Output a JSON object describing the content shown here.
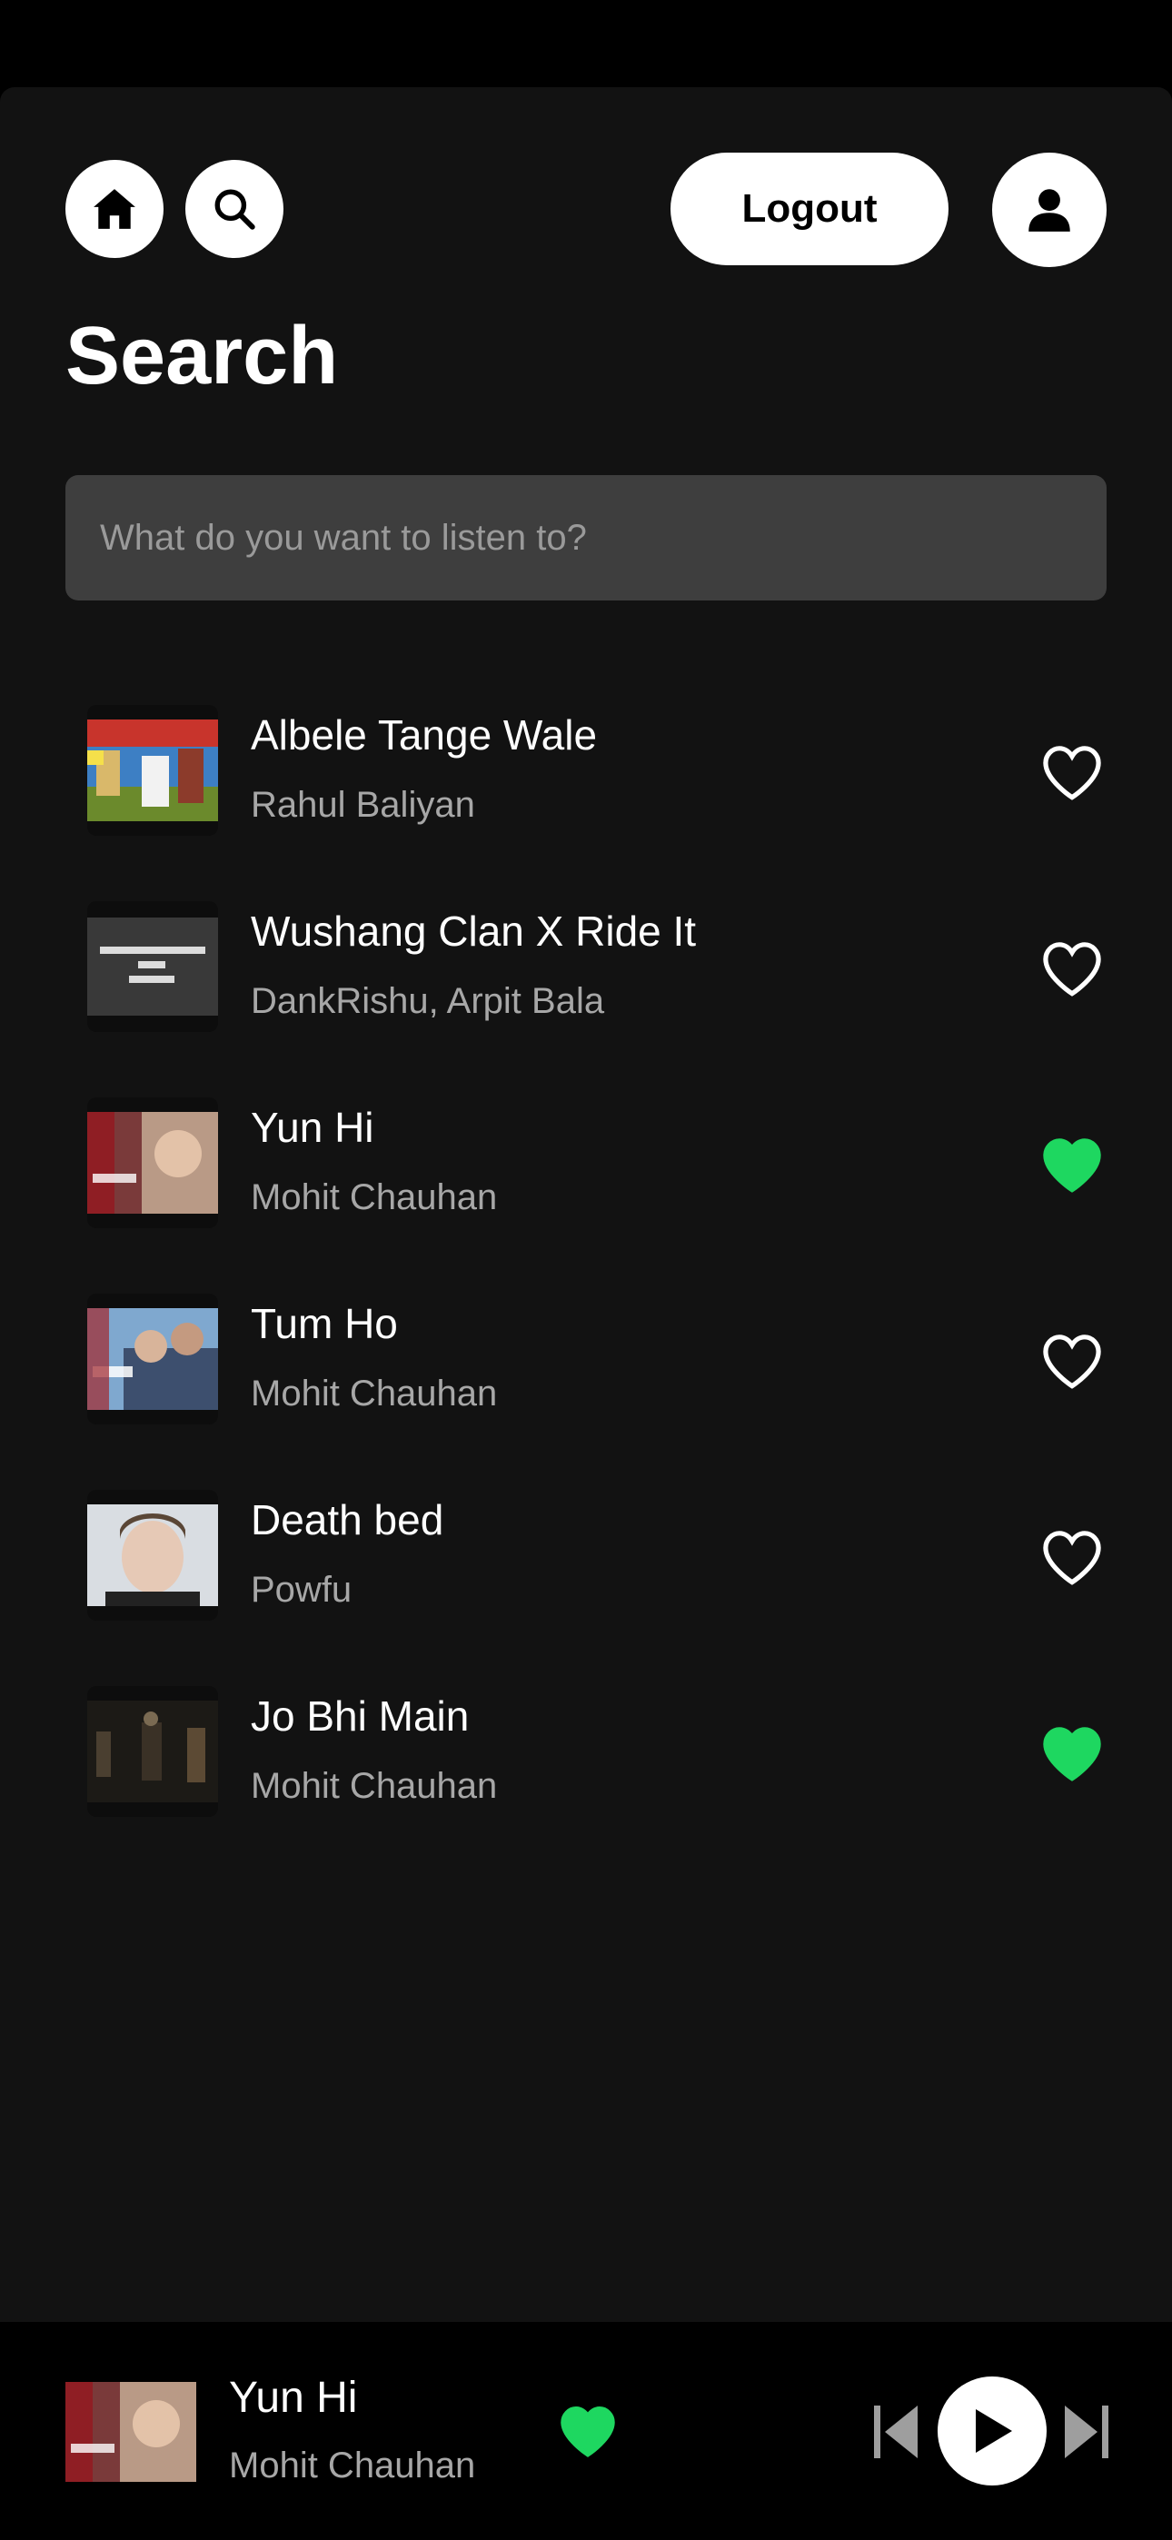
{
  "header": {
    "home_icon": "home-icon",
    "search_icon": "search-icon",
    "logout_label": "Logout",
    "profile_icon": "user-icon"
  },
  "page_title": "Search",
  "search": {
    "placeholder": "What do you want to listen to?",
    "value": ""
  },
  "colors": {
    "accent_green": "#1ed760",
    "panel_bg": "#121212",
    "input_bg": "#3e3e3e",
    "secondary_text": "#a7a7a7"
  },
  "songs": [
    {
      "title": "Albele Tange Wale",
      "artist": "Rahul Baliyan",
      "liked": false
    },
    {
      "title": "Wushang Clan X Ride It",
      "artist": "DankRishu, Arpit Bala",
      "liked": false
    },
    {
      "title": "Yun Hi",
      "artist": "Mohit Chauhan",
      "liked": true
    },
    {
      "title": "Tum Ho",
      "artist": "Mohit Chauhan",
      "liked": false
    },
    {
      "title": "Death bed",
      "artist": "Powfu",
      "liked": false
    },
    {
      "title": "Jo Bhi Main",
      "artist": "Mohit Chauhan",
      "liked": true
    }
  ],
  "player": {
    "title": "Yun Hi",
    "artist": "Mohit Chauhan",
    "liked": true,
    "prev_icon": "skip-previous-icon",
    "play_icon": "play-icon",
    "next_icon": "skip-next-icon"
  }
}
